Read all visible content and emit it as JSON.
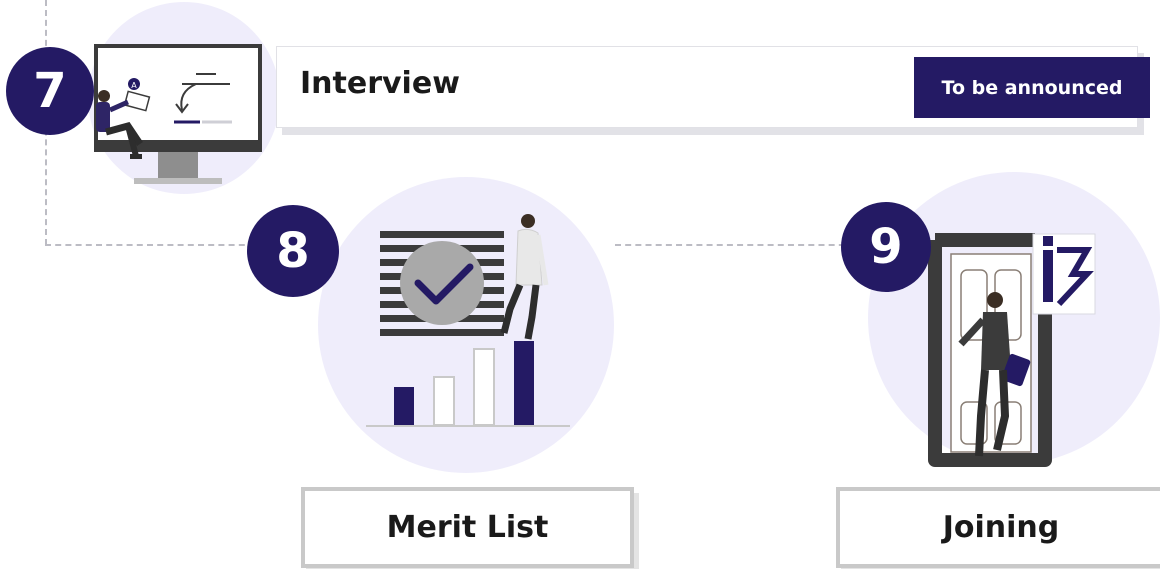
{
  "steps": [
    {
      "number": "7",
      "title": "Interview",
      "badge": "To be announced"
    },
    {
      "number": "8",
      "title": "Merit List"
    },
    {
      "number": "9",
      "title": "Joining"
    }
  ],
  "colors": {
    "primary": "#241a64",
    "bubble": "#efedfb",
    "border_gray": "#c9c9c9",
    "dash": "#bcbcc4"
  }
}
